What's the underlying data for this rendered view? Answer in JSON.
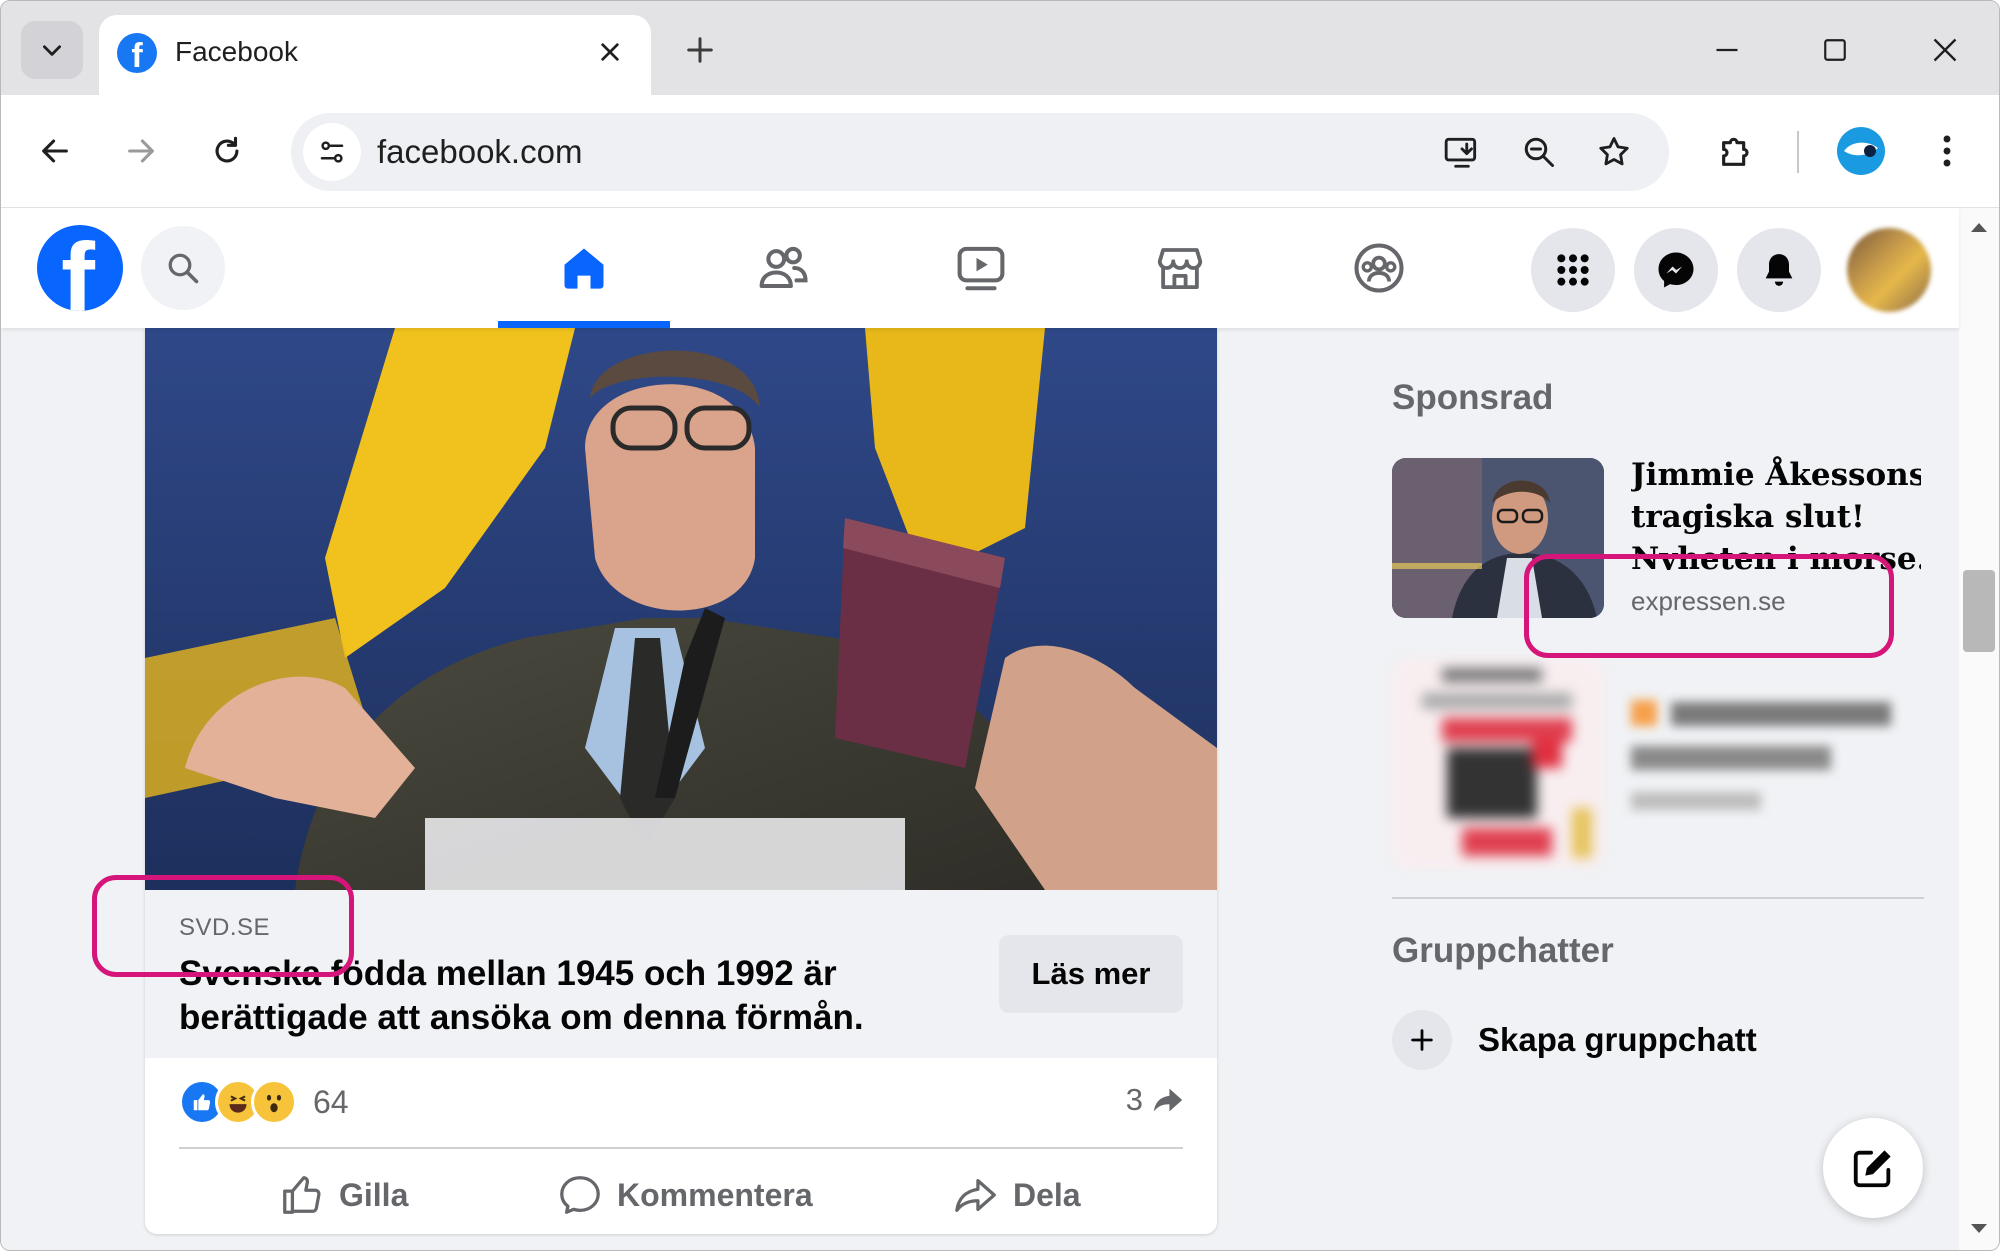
{
  "browser": {
    "tab_title": "Facebook",
    "favicon_letter": "f",
    "url": "facebook.com",
    "icons": [
      "chevron-down-icon",
      "close-icon",
      "plus-icon",
      "minimize-icon",
      "maximize-icon",
      "close-window-icon",
      "back-arrow-icon",
      "forward-arrow-icon",
      "reload-icon",
      "site-settings-icon",
      "install-app-icon",
      "zoom-icon",
      "star-icon",
      "extensions-icon",
      "profile-icon",
      "kebab-menu-icon"
    ]
  },
  "facebook": {
    "logo_letter": "f",
    "nav": [
      "home",
      "friends",
      "watch",
      "marketplace",
      "groups"
    ],
    "active_nav": "home",
    "brand_color": "#0866ff"
  },
  "post": {
    "domain": "SVD.SE",
    "title": "Svenska födda mellan 1945 och 1992 är berättigade att ansöka om denna förmån.",
    "read_more": "Läs mer",
    "reaction_count": "64",
    "share_count": "3",
    "actions": {
      "like": "Gilla",
      "comment": "Kommentera",
      "share": "Dela"
    }
  },
  "sidebar": {
    "sponsored_heading": "Sponsrad",
    "ad1": {
      "title_line1": "Jimmie Åkessons",
      "title_line2": "tragiska slut!",
      "title_line3": "Nyheten i morse...",
      "domain": "expressen.se"
    },
    "group_chats_heading": "Gruppchatter",
    "create_group": "Skapa gruppchatt"
  },
  "annotation_color": "#d6157a"
}
